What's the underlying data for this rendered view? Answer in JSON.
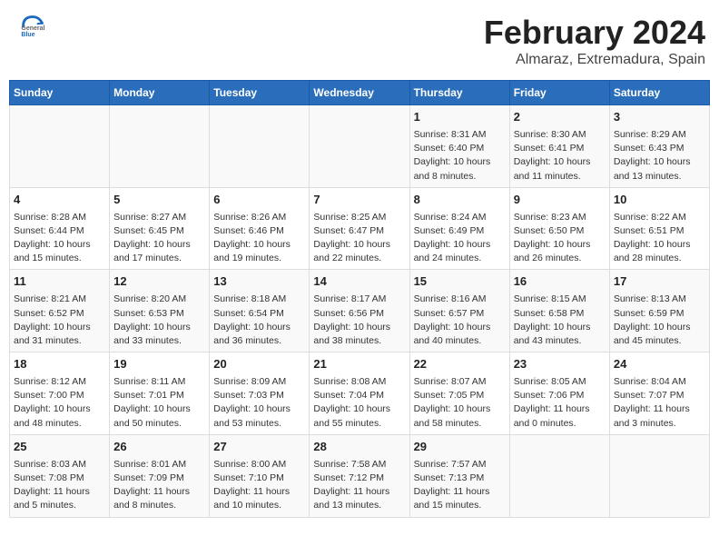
{
  "header": {
    "logo_line1": "General",
    "logo_line2": "Blue",
    "month": "February 2024",
    "location": "Almaraz, Extremadura, Spain"
  },
  "weekdays": [
    "Sunday",
    "Monday",
    "Tuesday",
    "Wednesday",
    "Thursday",
    "Friday",
    "Saturday"
  ],
  "weeks": [
    [
      {
        "day": "",
        "info": ""
      },
      {
        "day": "",
        "info": ""
      },
      {
        "day": "",
        "info": ""
      },
      {
        "day": "",
        "info": ""
      },
      {
        "day": "1",
        "info": "Sunrise: 8:31 AM\nSunset: 6:40 PM\nDaylight: 10 hours\nand 8 minutes."
      },
      {
        "day": "2",
        "info": "Sunrise: 8:30 AM\nSunset: 6:41 PM\nDaylight: 10 hours\nand 11 minutes."
      },
      {
        "day": "3",
        "info": "Sunrise: 8:29 AM\nSunset: 6:43 PM\nDaylight: 10 hours\nand 13 minutes."
      }
    ],
    [
      {
        "day": "4",
        "info": "Sunrise: 8:28 AM\nSunset: 6:44 PM\nDaylight: 10 hours\nand 15 minutes."
      },
      {
        "day": "5",
        "info": "Sunrise: 8:27 AM\nSunset: 6:45 PM\nDaylight: 10 hours\nand 17 minutes."
      },
      {
        "day": "6",
        "info": "Sunrise: 8:26 AM\nSunset: 6:46 PM\nDaylight: 10 hours\nand 19 minutes."
      },
      {
        "day": "7",
        "info": "Sunrise: 8:25 AM\nSunset: 6:47 PM\nDaylight: 10 hours\nand 22 minutes."
      },
      {
        "day": "8",
        "info": "Sunrise: 8:24 AM\nSunset: 6:49 PM\nDaylight: 10 hours\nand 24 minutes."
      },
      {
        "day": "9",
        "info": "Sunrise: 8:23 AM\nSunset: 6:50 PM\nDaylight: 10 hours\nand 26 minutes."
      },
      {
        "day": "10",
        "info": "Sunrise: 8:22 AM\nSunset: 6:51 PM\nDaylight: 10 hours\nand 28 minutes."
      }
    ],
    [
      {
        "day": "11",
        "info": "Sunrise: 8:21 AM\nSunset: 6:52 PM\nDaylight: 10 hours\nand 31 minutes."
      },
      {
        "day": "12",
        "info": "Sunrise: 8:20 AM\nSunset: 6:53 PM\nDaylight: 10 hours\nand 33 minutes."
      },
      {
        "day": "13",
        "info": "Sunrise: 8:18 AM\nSunset: 6:54 PM\nDaylight: 10 hours\nand 36 minutes."
      },
      {
        "day": "14",
        "info": "Sunrise: 8:17 AM\nSunset: 6:56 PM\nDaylight: 10 hours\nand 38 minutes."
      },
      {
        "day": "15",
        "info": "Sunrise: 8:16 AM\nSunset: 6:57 PM\nDaylight: 10 hours\nand 40 minutes."
      },
      {
        "day": "16",
        "info": "Sunrise: 8:15 AM\nSunset: 6:58 PM\nDaylight: 10 hours\nand 43 minutes."
      },
      {
        "day": "17",
        "info": "Sunrise: 8:13 AM\nSunset: 6:59 PM\nDaylight: 10 hours\nand 45 minutes."
      }
    ],
    [
      {
        "day": "18",
        "info": "Sunrise: 8:12 AM\nSunset: 7:00 PM\nDaylight: 10 hours\nand 48 minutes."
      },
      {
        "day": "19",
        "info": "Sunrise: 8:11 AM\nSunset: 7:01 PM\nDaylight: 10 hours\nand 50 minutes."
      },
      {
        "day": "20",
        "info": "Sunrise: 8:09 AM\nSunset: 7:03 PM\nDaylight: 10 hours\nand 53 minutes."
      },
      {
        "day": "21",
        "info": "Sunrise: 8:08 AM\nSunset: 7:04 PM\nDaylight: 10 hours\nand 55 minutes."
      },
      {
        "day": "22",
        "info": "Sunrise: 8:07 AM\nSunset: 7:05 PM\nDaylight: 10 hours\nand 58 minutes."
      },
      {
        "day": "23",
        "info": "Sunrise: 8:05 AM\nSunset: 7:06 PM\nDaylight: 11 hours\nand 0 minutes."
      },
      {
        "day": "24",
        "info": "Sunrise: 8:04 AM\nSunset: 7:07 PM\nDaylight: 11 hours\nand 3 minutes."
      }
    ],
    [
      {
        "day": "25",
        "info": "Sunrise: 8:03 AM\nSunset: 7:08 PM\nDaylight: 11 hours\nand 5 minutes."
      },
      {
        "day": "26",
        "info": "Sunrise: 8:01 AM\nSunset: 7:09 PM\nDaylight: 11 hours\nand 8 minutes."
      },
      {
        "day": "27",
        "info": "Sunrise: 8:00 AM\nSunset: 7:10 PM\nDaylight: 11 hours\nand 10 minutes."
      },
      {
        "day": "28",
        "info": "Sunrise: 7:58 AM\nSunset: 7:12 PM\nDaylight: 11 hours\nand 13 minutes."
      },
      {
        "day": "29",
        "info": "Sunrise: 7:57 AM\nSunset: 7:13 PM\nDaylight: 11 hours\nand 15 minutes."
      },
      {
        "day": "",
        "info": ""
      },
      {
        "day": "",
        "info": ""
      }
    ]
  ]
}
